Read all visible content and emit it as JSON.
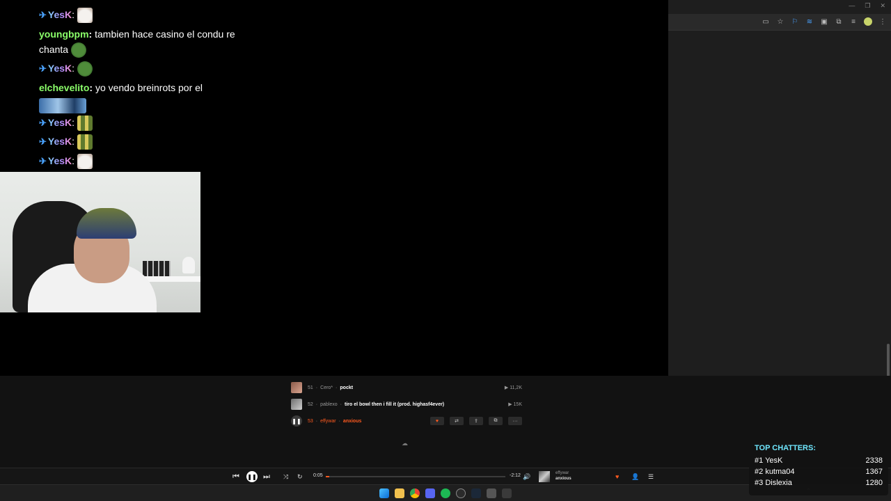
{
  "chat": {
    "lines": [
      {
        "user": "YesK",
        "text": "",
        "emote": "cat-emote",
        "pinned": true
      },
      {
        "user": "youngbpm",
        "text": "tambien hace casino el condu re",
        "text2": "chanta",
        "emote": "pepe-emote",
        "color": "#8bff6a"
      },
      {
        "user": "YesK",
        "text": "",
        "emote": "pepe-emote",
        "pinned": true
      },
      {
        "user": "elchevelito",
        "text": "yo vendo breinrots por el",
        "emote": "wide-emote",
        "color": "#8bff6a"
      },
      {
        "user": "YesK",
        "text": "",
        "emote": "eyes-emote",
        "pinned": true
      },
      {
        "user": "YesK",
        "text": "",
        "emote": "eyes-emote",
        "pinned": true
      },
      {
        "user": "YesK",
        "text": "",
        "emote": "cat-emote",
        "pinned": true
      }
    ]
  },
  "soundcloud": {
    "tracks": [
      {
        "num": "51",
        "artist": "Cero*",
        "title": "pockt",
        "plays": "11,2K",
        "active": false
      },
      {
        "num": "52",
        "artist": "pablexo",
        "title": "tiro el bowl then i fill it (prod. highasf4ever)",
        "plays": "15K",
        "active": false
      },
      {
        "num": "53",
        "artist": "effywar",
        "title": "anxious",
        "plays": "",
        "active": true
      }
    ]
  },
  "player": {
    "elapsed": "0:05",
    "remaining": "-2:12",
    "progress_fraction": 0.02,
    "now_playing_artist": "effywar",
    "now_playing_title": "anxious"
  },
  "top_chatters": {
    "title": "TOP CHATTERS:",
    "rows": [
      {
        "rank": "#1",
        "name": "YesK",
        "count": "2338"
      },
      {
        "rank": "#2",
        "name": "kutma04",
        "count": "1367"
      },
      {
        "rank": "#3",
        "name": "Dislexia",
        "count": "1280"
      }
    ]
  },
  "colors": {
    "accent": "#ff5a1f",
    "username_green": "#8bff6a",
    "top_chatters_title": "#6fe7ff"
  }
}
